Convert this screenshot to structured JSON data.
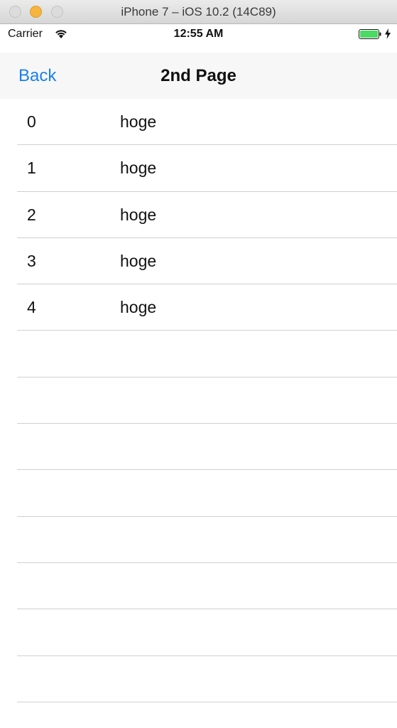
{
  "window": {
    "title": "iPhone 7 – iOS 10.2 (14C89)"
  },
  "status_bar": {
    "carrier": "Carrier",
    "time": "12:55 AM",
    "wifi_icon": "wifi-icon",
    "battery_icon": "battery-icon",
    "battery_color": "#4cd964",
    "charging_icon": "bolt-icon"
  },
  "navbar": {
    "back_label": "Back",
    "title": "2nd Page",
    "tint_color": "#1a7ff0"
  },
  "table": {
    "rows": [
      {
        "index": "0",
        "text": "hoge"
      },
      {
        "index": "1",
        "text": "hoge"
      },
      {
        "index": "2",
        "text": "hoge"
      },
      {
        "index": "3",
        "text": "hoge"
      },
      {
        "index": "4",
        "text": "hoge"
      }
    ],
    "empty_rows": 9
  }
}
